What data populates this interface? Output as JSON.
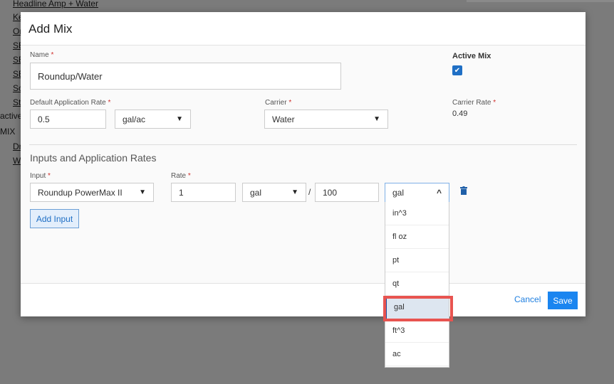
{
  "background": {
    "rows": [
      "Headline Amp + Water",
      "Ke",
      "Or",
      "SE",
      "SE",
      "SE",
      "Sc",
      "St"
    ],
    "active_label": "active",
    "mix_label": "MIX",
    "rows2": [
      "Dr",
      "W"
    ]
  },
  "modal": {
    "title": "Add Mix",
    "name_label": "Name",
    "name_value": "Roundup/Water",
    "active_mix_label": "Active Mix",
    "active_mix_checked": true,
    "rate_label": "Default Application Rate",
    "rate_value": "0.5",
    "rate_unit": "gal/ac",
    "carrier_label": "Carrier",
    "carrier_value": "Water",
    "carrier_rate_label": "Carrier Rate",
    "carrier_rate_value": "0.49",
    "required_mark": "*",
    "section_title": "Inputs and Application Rates",
    "input_label": "Input",
    "input_value": "Roundup PowerMax II",
    "rate2_label": "Rate",
    "rate2_value": "1",
    "rate2_unit": "gal",
    "slash": "/",
    "per_value": "100",
    "per_unit": "gal",
    "add_input": "Add Input",
    "cancel": "Cancel",
    "save": "Save"
  },
  "dropdown": {
    "options": [
      "in^3",
      "fl oz",
      "pt",
      "qt",
      "gal",
      "ft^3",
      "ac"
    ],
    "highlighted": "gal"
  },
  "colors": {
    "accent": "#1a85f0",
    "highlight_border": "#e85450"
  }
}
